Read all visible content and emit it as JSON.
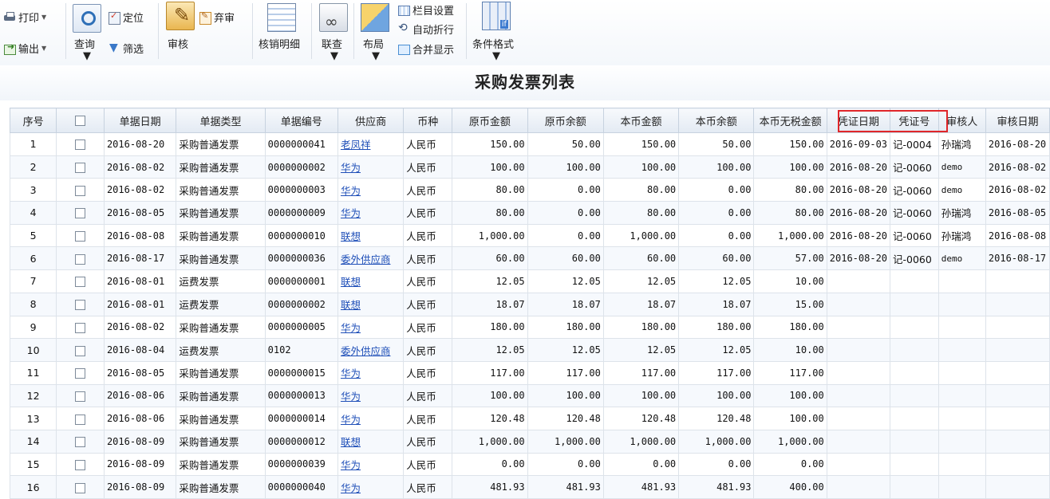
{
  "toolbar": {
    "print": "打印",
    "export": "输出",
    "query": "查询",
    "locate": "定位",
    "filter": "筛选",
    "audit": "审核",
    "discard": "弃审",
    "write_off_detail": "核销明细",
    "link_query": "联查",
    "layout": "布局",
    "column_settings": "栏目设置",
    "auto_wrap": "自动折行",
    "merge_display": "合并显示",
    "conditional_format": "条件格式"
  },
  "page_title": "采购发票列表",
  "table": {
    "columns": [
      "序号",
      "单据日期",
      "单据类型",
      "单据编号",
      "供应商",
      "币种",
      "原币金额",
      "原币余额",
      "本币金额",
      "本币余额",
      "本币无税金额",
      "凭证日期",
      "凭证号",
      "审核人",
      "审核日期"
    ],
    "rows": [
      [
        "1",
        "2016-08-20",
        "采购普通发票",
        "0000000041",
        "老凤祥",
        "人民币",
        "150.00",
        "50.00",
        "150.00",
        "50.00",
        "150.00",
        "2016-09-03",
        "记-0004",
        "孙瑞鸿",
        "2016-08-20"
      ],
      [
        "2",
        "2016-08-02",
        "采购普通发票",
        "0000000002",
        "华为",
        "人民币",
        "100.00",
        "100.00",
        "100.00",
        "100.00",
        "100.00",
        "2016-08-20",
        "记-0060",
        "demo",
        "2016-08-02"
      ],
      [
        "3",
        "2016-08-02",
        "采购普通发票",
        "0000000003",
        "华为",
        "人民币",
        "80.00",
        "0.00",
        "80.00",
        "0.00",
        "80.00",
        "2016-08-20",
        "记-0060",
        "demo",
        "2016-08-02"
      ],
      [
        "4",
        "2016-08-05",
        "采购普通发票",
        "0000000009",
        "华为",
        "人民币",
        "80.00",
        "0.00",
        "80.00",
        "0.00",
        "80.00",
        "2016-08-20",
        "记-0060",
        "孙瑞鸿",
        "2016-08-05"
      ],
      [
        "5",
        "2016-08-08",
        "采购普通发票",
        "0000000010",
        "联想",
        "人民币",
        "1,000.00",
        "0.00",
        "1,000.00",
        "0.00",
        "1,000.00",
        "2016-08-20",
        "记-0060",
        "孙瑞鸿",
        "2016-08-08"
      ],
      [
        "6",
        "2016-08-17",
        "采购普通发票",
        "0000000036",
        "委外供应商",
        "人民币",
        "60.00",
        "60.00",
        "60.00",
        "60.00",
        "57.00",
        "2016-08-20",
        "记-0060",
        "demo",
        "2016-08-17"
      ],
      [
        "7",
        "2016-08-01",
        "运费发票",
        "0000000001",
        "联想",
        "人民币",
        "12.05",
        "12.05",
        "12.05",
        "12.05",
        "10.00",
        "",
        "",
        "",
        ""
      ],
      [
        "8",
        "2016-08-01",
        "运费发票",
        "0000000002",
        "联想",
        "人民币",
        "18.07",
        "18.07",
        "18.07",
        "18.07",
        "15.00",
        "",
        "",
        "",
        ""
      ],
      [
        "9",
        "2016-08-02",
        "采购普通发票",
        "0000000005",
        "华为",
        "人民币",
        "180.00",
        "180.00",
        "180.00",
        "180.00",
        "180.00",
        "",
        "",
        "",
        ""
      ],
      [
        "10",
        "2016-08-04",
        "运费发票",
        "0102",
        "委外供应商",
        "人民币",
        "12.05",
        "12.05",
        "12.05",
        "12.05",
        "10.00",
        "",
        "",
        "",
        ""
      ],
      [
        "11",
        "2016-08-05",
        "采购普通发票",
        "0000000015",
        "华为",
        "人民币",
        "117.00",
        "117.00",
        "117.00",
        "117.00",
        "117.00",
        "",
        "",
        "",
        ""
      ],
      [
        "12",
        "2016-08-06",
        "采购普通发票",
        "0000000013",
        "华为",
        "人民币",
        "100.00",
        "100.00",
        "100.00",
        "100.00",
        "100.00",
        "",
        "",
        "",
        ""
      ],
      [
        "13",
        "2016-08-06",
        "采购普通发票",
        "0000000014",
        "华为",
        "人民币",
        "120.48",
        "120.48",
        "120.48",
        "120.48",
        "100.00",
        "",
        "",
        "",
        ""
      ],
      [
        "14",
        "2016-08-09",
        "采购普通发票",
        "0000000012",
        "联想",
        "人民币",
        "1,000.00",
        "1,000.00",
        "1,000.00",
        "1,000.00",
        "1,000.00",
        "",
        "",
        "",
        ""
      ],
      [
        "15",
        "2016-08-09",
        "采购普通发票",
        "0000000039",
        "华为",
        "人民币",
        "0.00",
        "0.00",
        "0.00",
        "0.00",
        "0.00",
        "",
        "",
        "",
        ""
      ],
      [
        "16",
        "2016-08-09",
        "采购普通发票",
        "0000000040",
        "华为",
        "人民币",
        "481.93",
        "481.93",
        "481.93",
        "481.93",
        "400.00",
        "",
        "",
        "",
        ""
      ]
    ]
  }
}
